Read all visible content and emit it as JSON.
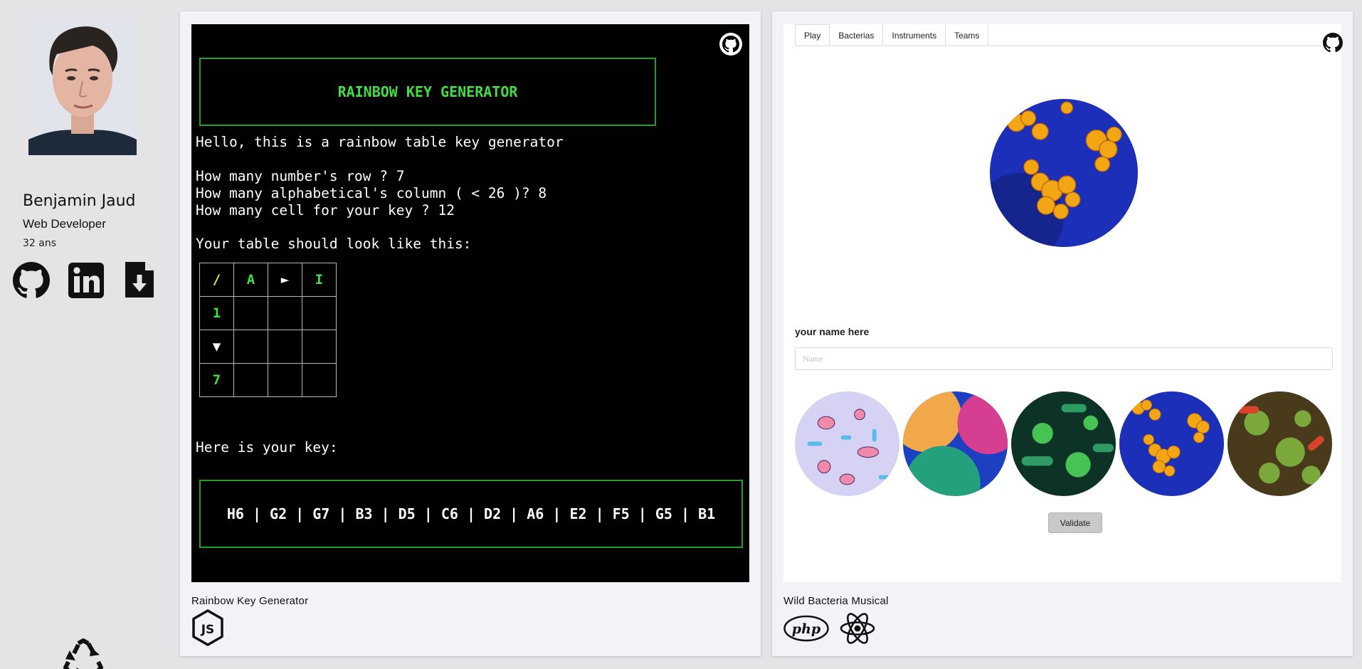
{
  "profile": {
    "name": "Benjamin Jaud",
    "job": "Web Developer",
    "age": "32 ans",
    "social": [
      "github-icon",
      "linkedin-icon",
      "download-cv-icon"
    ]
  },
  "projects": [
    {
      "title": "Rainbow Key Generator",
      "tech": [
        "nodejs-icon"
      ],
      "terminal": {
        "header": "RAINBOW KEY GENERATOR",
        "intro": "Hello, this is a rainbow table key generator",
        "q_rows": "How many number's row ? 7",
        "q_cols": "How many alphabetical's column ( < 26 )? 8",
        "q_cells": "How many cell for your key ? 12",
        "table_intro": "Your table should look like this:",
        "table": {
          "corner": "/",
          "first_col": "A",
          "col_more": "►",
          "last_col": "I",
          "first_row": "1",
          "row_more": "▼",
          "last_row": "7"
        },
        "key_intro": "Here is your key:",
        "key": "H6 | G2 | G7 | B3 | D5 | C6 | D2 | A6 | E2 | F5 | G5 | B1"
      }
    },
    {
      "title": "Wild Bacteria Musical",
      "tech": [
        "php-icon",
        "react-icon"
      ],
      "app": {
        "tabs": [
          "Play",
          "Bacterias",
          "Instruments",
          "Teams"
        ],
        "name_label": "your name here",
        "name_placeholder": "Name",
        "name_value": "",
        "validate_label": "Validate",
        "thumbnails": [
          "bacteria-pink-pattern",
          "bacteria-colored-cells",
          "bacteria-green-virus",
          "bacteria-orange-on-blue",
          "bacteria-green-red"
        ]
      }
    }
  ]
}
